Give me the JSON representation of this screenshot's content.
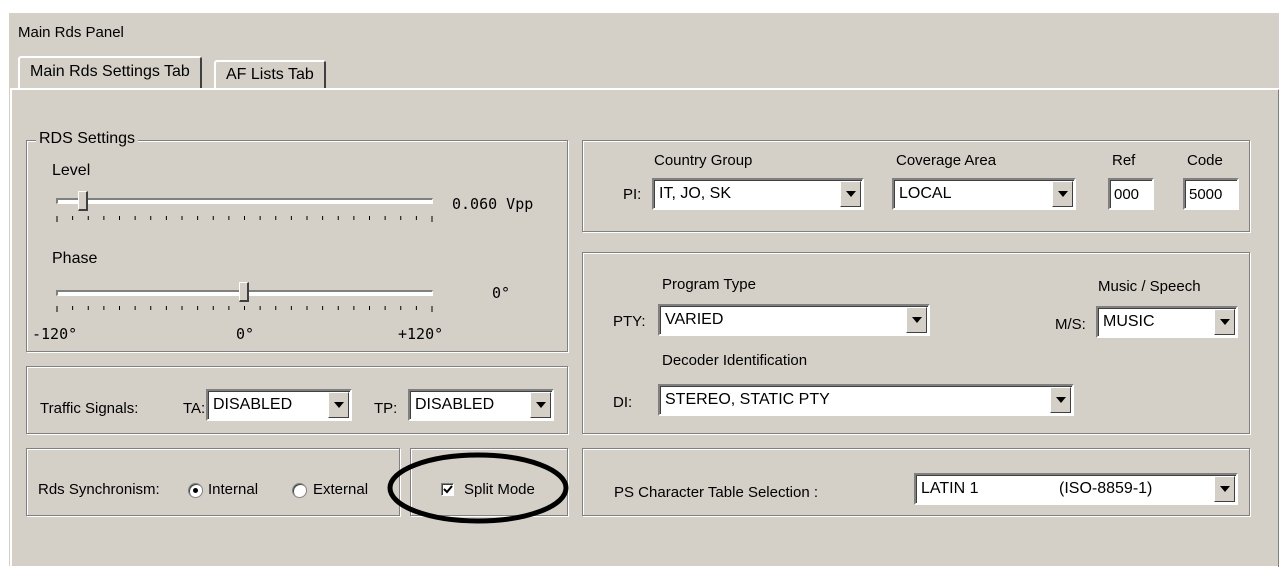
{
  "window": {
    "title": "Main Rds Panel"
  },
  "tabs": [
    {
      "label": "Main Rds Settings Tab",
      "active": true
    },
    {
      "label": "AF Lists Tab",
      "active": false
    }
  ],
  "rds_settings": {
    "legend": "RDS Settings",
    "level": {
      "label": "Level",
      "value": "0.060 Vpp",
      "position": 0.06
    },
    "phase": {
      "label": "Phase",
      "value": "0°",
      "position": 0.5,
      "min": "-120°",
      "mid": "0°",
      "max": "+120°"
    }
  },
  "traffic": {
    "label": "Traffic Signals:",
    "ta_label": "TA:",
    "ta_value": "DISABLED",
    "tp_label": "TP:",
    "tp_value": "DISABLED"
  },
  "sync": {
    "label": "Rds Synchronism:",
    "internal": "Internal",
    "external": "External",
    "selected": "Internal"
  },
  "split_mode": {
    "label": "Split Mode",
    "checked": true
  },
  "pi": {
    "label": "PI:",
    "country_group_label": "Country Group",
    "country_group_value": "IT, JO, SK",
    "coverage_label": "Coverage Area",
    "coverage_value": "LOCAL",
    "ref_label": "Ref",
    "ref_value": "000",
    "code_label": "Code",
    "code_value": "5000"
  },
  "pty": {
    "label": "PTY:",
    "program_type_label": "Program Type",
    "program_type_value": "VARIED",
    "ms_header": "Music / Speech",
    "ms_label": "M/S:",
    "ms_value": "MUSIC",
    "di_section_label": "Decoder Identification",
    "di_label": "DI:",
    "di_value": "STEREO, STATIC PTY"
  },
  "ps_table": {
    "label": "PS Character Table Selection :",
    "value": "LATIN 1",
    "value_detail": "(ISO-8859-1)"
  },
  "colors": {
    "face": "#d4d0c8",
    "shadow": "#808080",
    "annotation": "#000000"
  }
}
